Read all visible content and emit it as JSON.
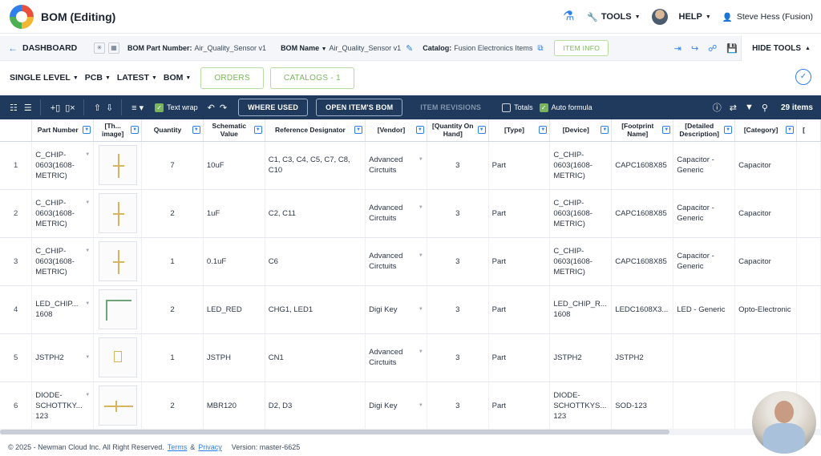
{
  "app": {
    "title": "BOM (Editing)",
    "tools_label": "TOOLS",
    "help_label": "HELP",
    "user_name": "Steve Hess (Fusion)"
  },
  "bar2": {
    "dashboard_label": "DASHBOARD",
    "bom_part_number_key": "BOM Part Number:",
    "bom_part_number_val": "Air_Quality_Sensor v1",
    "bom_name_key": "BOM Name",
    "bom_name_val": "Air_Quality_Sensor v1",
    "catalog_key": "Catalog:",
    "catalog_val": "Fusion Electronics Items",
    "item_info_label": "ITEM INFO",
    "hide_tools_label": "HIDE TOOLS"
  },
  "filters": {
    "level": "SINGLE LEVEL",
    "type": "PCB",
    "revision": "LATEST",
    "view": "BOM",
    "orders_label": "ORDERS",
    "catalogs_label": "CATALOGS - 1"
  },
  "toolbar": {
    "text_wrap_label": "Text wrap",
    "where_used_label": "WHERE USED",
    "open_items_bom_label": "OPEN ITEM'S BOM",
    "item_revisions_label": "ITEM REVISIONS",
    "totals_label": "Totals",
    "auto_formula_label": "Auto formula",
    "items_count": "29 items"
  },
  "columns": [
    "",
    "Part Number",
    "[Th... image]",
    "Quantity",
    "Schematic Value",
    "Reference Designator",
    "[Vendor]",
    "[Quantity On Hand]",
    "[Type]",
    "[Device]",
    "[Footprint Name]",
    "[Detailed Description]",
    "[Category]",
    "["
  ],
  "rows": [
    {
      "idx": "1",
      "part": "C_CHIP-0603(1608-METRIC)",
      "qty": "7",
      "value": "10uF",
      "ref": "C1, C3, C4, C5, C7, C8, C10",
      "vendor": "Advanced Circtuits",
      "onhand": "3",
      "type": "Part",
      "device": "C_CHIP-0603(1608-METRIC)",
      "footprint": "CAPC1608X85",
      "desc": "Capacitor - Generic",
      "category": "Capacitor"
    },
    {
      "idx": "2",
      "part": "C_CHIP-0603(1608-METRIC)",
      "qty": "2",
      "value": "1uF",
      "ref": "C2, C11",
      "vendor": "Advanced Circtuits",
      "onhand": "3",
      "type": "Part",
      "device": "C_CHIP-0603(1608-METRIC)",
      "footprint": "CAPC1608X85",
      "desc": "Capacitor - Generic",
      "category": "Capacitor"
    },
    {
      "idx": "3",
      "part": "C_CHIP-0603(1608-METRIC)",
      "qty": "1",
      "value": "0.1uF",
      "ref": "C6",
      "vendor": "Advanced Circtuits",
      "onhand": "3",
      "type": "Part",
      "device": "C_CHIP-0603(1608-METRIC)",
      "footprint": "CAPC1608X85",
      "desc": "Capacitor - Generic",
      "category": "Capacitor"
    },
    {
      "idx": "4",
      "part": "LED_CHIP... 1608",
      "qty": "2",
      "value": "LED_RED",
      "ref": "CHG1, LED1",
      "vendor": "Digi Key",
      "onhand": "3",
      "type": "Part",
      "device": "LED_CHIP_R... 1608",
      "footprint": "LEDC1608X3...",
      "desc": "LED - Generic",
      "category": "Opto-Electronic"
    },
    {
      "idx": "5",
      "part": "JSTPH2",
      "qty": "1",
      "value": "JSTPH",
      "ref": "CN1",
      "vendor": "Advanced Circtuits",
      "onhand": "3",
      "type": "Part",
      "device": "JSTPH2",
      "footprint": "JSTPH2",
      "desc": "",
      "category": ""
    },
    {
      "idx": "6",
      "part": "DIODE-SCHOTTKY... 123",
      "qty": "2",
      "value": "MBR120",
      "ref": "D2, D3",
      "vendor": "Digi Key",
      "onhand": "3",
      "type": "Part",
      "device": "DIODE-SCHOTTKYS... 123",
      "footprint": "SOD-123",
      "desc": "",
      "category": ""
    }
  ],
  "footer": {
    "copyright": "© 2025 - Newman Cloud Inc. All Right Reserved.",
    "terms_label": "Terms",
    "amp": "&",
    "privacy_label": "Privacy",
    "version": "Version: master-6625"
  },
  "colors": {
    "accent": "#2f80ed",
    "toolbar_bg": "#1f3a5c",
    "green": "#7ab55c"
  }
}
